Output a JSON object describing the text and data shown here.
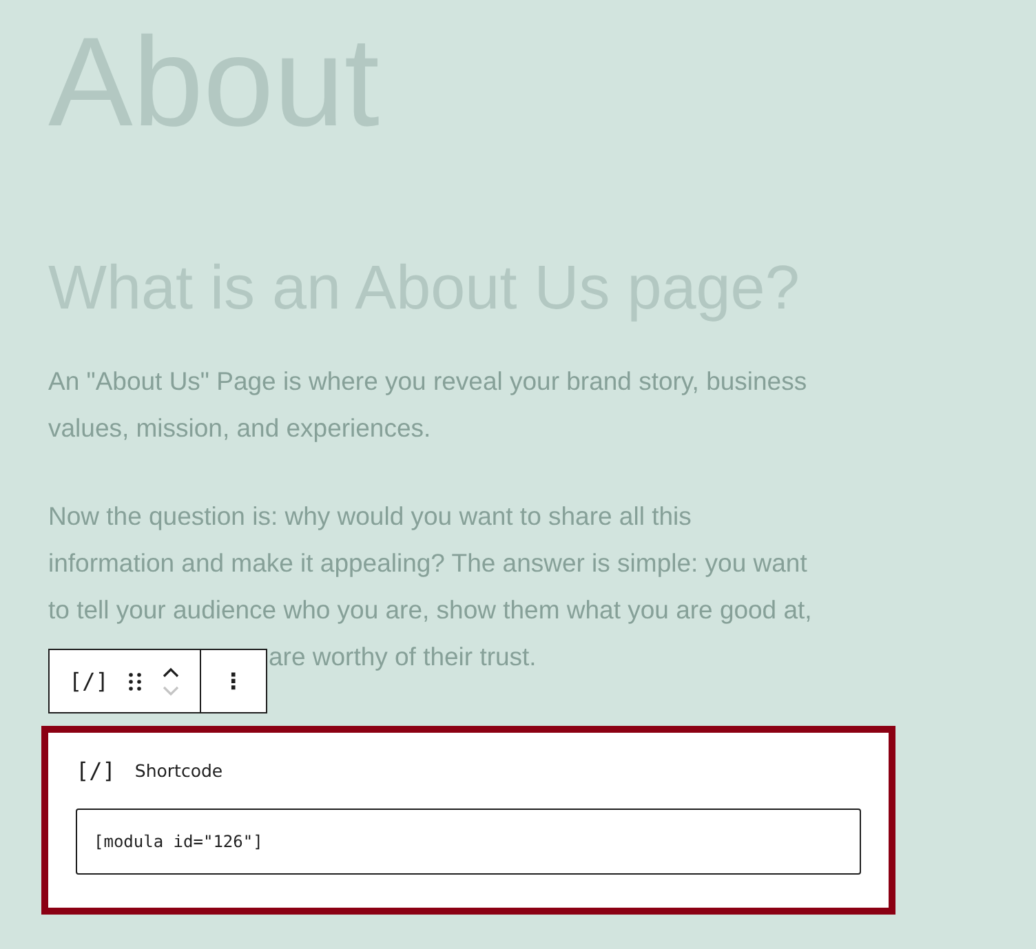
{
  "title": "About",
  "heading": "What is an About Us page?",
  "paragraphs": [
    {
      "lines": [
        "An \"About Us\" Page is where you reveal your brand story, business",
        "values, mission, and experiences."
      ]
    },
    {
      "lines": [
        "Now the question is: why would you want to share all this",
        "information and make it appealing? The answer is simple: you want",
        "to tell your audience who you are, show them what you are good at,"
      ],
      "partial_line": "are worthy of their trust."
    }
  ],
  "toolbar": {
    "block_icon": "[/]",
    "more_icon": "⋮"
  },
  "shortcode_block": {
    "selected": true,
    "icon": "[/]",
    "label": "Shortcode",
    "value": "[modula id=\"126\"]"
  }
}
